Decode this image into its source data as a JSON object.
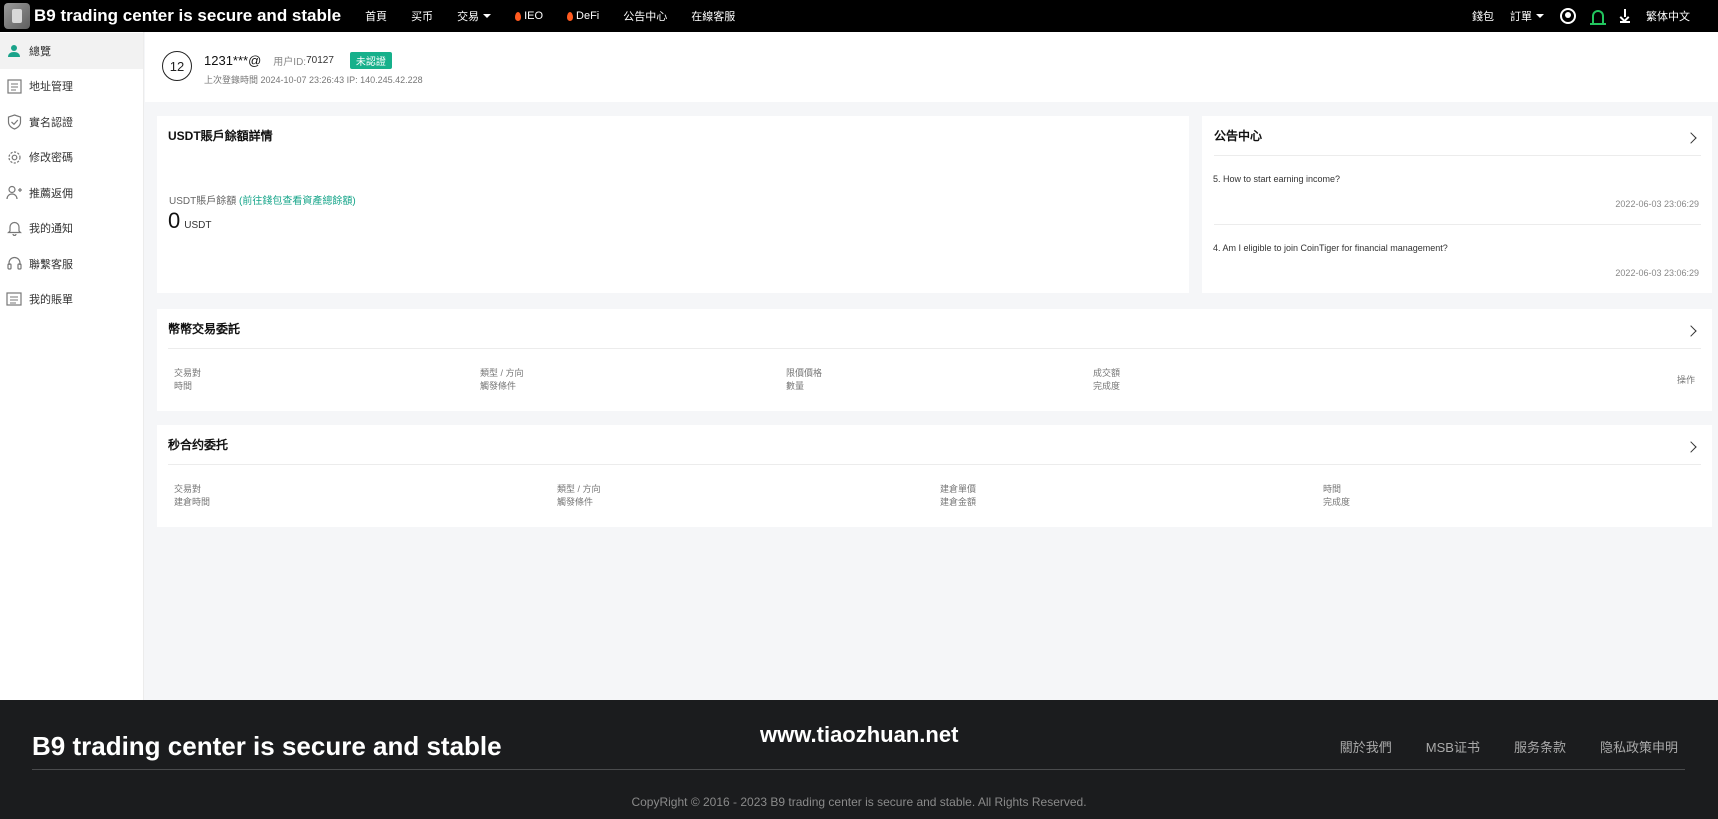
{
  "topnav": {
    "brand": "B9 trading center is secure and stable",
    "links": [
      "首頁",
      "买币",
      "交易",
      "IEO",
      "DeFi",
      "公告中心",
      "在線客服"
    ],
    "right": {
      "wallet": "錢包",
      "orders": "訂單",
      "language": "繁体中文"
    }
  },
  "sidebar": {
    "items": [
      "總覽",
      "地址管理",
      "實名認證",
      "修改密碼",
      "推薦返佣",
      "我的通知",
      "聯繫客服",
      "我的賬單"
    ],
    "active_index": 0
  },
  "account": {
    "avatar_text": "12",
    "name": "1231***@",
    "uid_label": "用户ID:",
    "uid": "70127",
    "status_badge": "未認證",
    "last_login": "上次登錄時間 2024-10-07 23:26:43   IP: 140.245.42.228"
  },
  "usdt_card": {
    "title": "USDT賬戶餘額詳情",
    "balance_label": "USDT賬戶餘額",
    "balance_link": "(前往錢包查看資產總餘額)",
    "balance_value": "0",
    "balance_unit": "USDT"
  },
  "notice_card": {
    "title": "公告中心",
    "items": [
      {
        "text": "5. How to start earning income?",
        "time": "2022-06-03 23:06:29"
      },
      {
        "text": "4. Am I eligible to join CoinTiger for financial management?",
        "time": "2022-06-03 23:06:29"
      }
    ]
  },
  "coin_orders": {
    "title": "幣幣交易委託",
    "columns": [
      [
        "交易對",
        "時間"
      ],
      [
        "類型 / 方向",
        "觸發條件"
      ],
      [
        "限價價格",
        "數量"
      ],
      [
        "成交額",
        "完成度"
      ]
    ],
    "action_col": "操作"
  },
  "second_contract": {
    "title": "秒合约委托",
    "columns": [
      [
        "交易對",
        "建倉時間"
      ],
      [
        "類型 / 方向",
        "觸發條件"
      ],
      [
        "建倉單價",
        "建倉金額"
      ],
      [
        "時間",
        "完成度"
      ]
    ]
  },
  "footer": {
    "brand": "B9 trading center is secure and stable",
    "watermark": "www.tiaozhuan.net",
    "links": [
      "關於我們",
      "MSB证书",
      "服务条款",
      "隐私政策申明"
    ],
    "copyright": "CopyRight © 2016 - 2023 B9 trading center is secure and stable. All Rights Reserved."
  },
  "colors": {
    "accent": "#16b08b",
    "topnav_bg": "#000000",
    "footer_bg": "#1b1c1e",
    "bell": "#22c55e"
  }
}
